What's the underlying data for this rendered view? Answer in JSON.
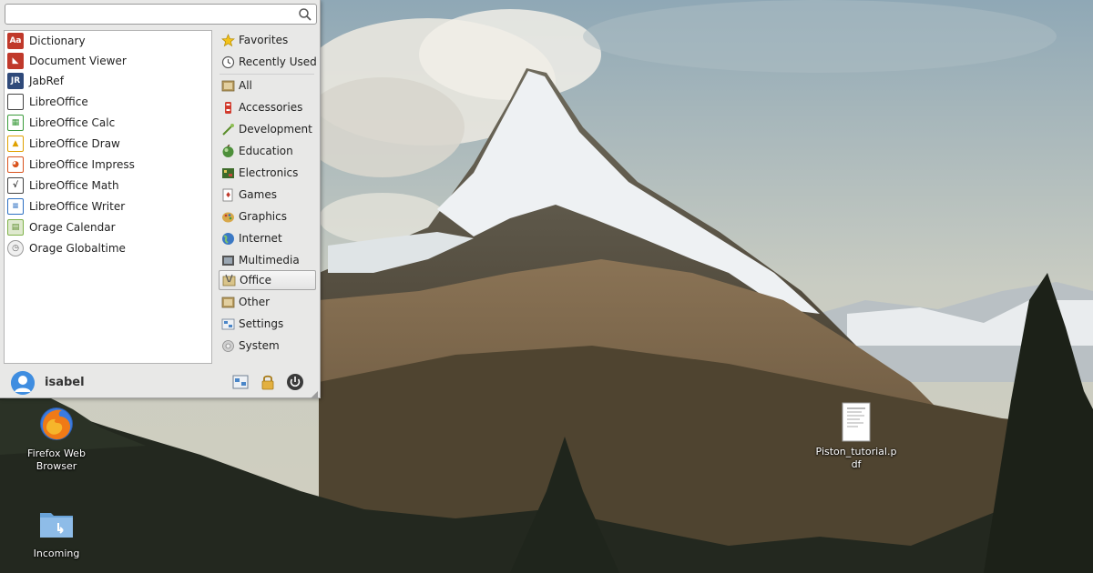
{
  "menu": {
    "search": {
      "placeholder": "",
      "value": "",
      "icon": "search-icon"
    },
    "applications": [
      {
        "label": "Dictionary",
        "icon": "dictionary-icon",
        "color": "#c0392b"
      },
      {
        "label": "Document Viewer",
        "icon": "document-viewer-icon",
        "color": "#c0392b"
      },
      {
        "label": "JabRef",
        "icon": "jabref-icon",
        "color": "#2f4a7a"
      },
      {
        "label": "LibreOffice",
        "icon": "libreoffice-icon",
        "color": "#444444"
      },
      {
        "label": "LibreOffice Calc",
        "icon": "libreoffice-calc-icon",
        "color": "#3b9b3b"
      },
      {
        "label": "LibreOffice Draw",
        "icon": "libreoffice-draw-icon",
        "color": "#e0a100"
      },
      {
        "label": "LibreOffice Impress",
        "icon": "libreoffice-impress-icon",
        "color": "#d9541e"
      },
      {
        "label": "LibreOffice Math",
        "icon": "libreoffice-math-icon",
        "color": "#444444"
      },
      {
        "label": "LibreOffice Writer",
        "icon": "libreoffice-writer-icon",
        "color": "#2d6fc2"
      },
      {
        "label": "Orage Calendar",
        "icon": "calendar-icon",
        "color": "#7fb24a"
      },
      {
        "label": "Orage Globaltime",
        "icon": "clock-icon",
        "color": "#9a9a9a"
      }
    ],
    "categories": [
      {
        "label": "Favorites",
        "icon": "star-icon"
      },
      {
        "label": "Recently Used",
        "icon": "history-icon"
      },
      {
        "label": "All",
        "icon": "all-folder-icon"
      },
      {
        "label": "Accessories",
        "icon": "accessories-icon"
      },
      {
        "label": "Development",
        "icon": "development-icon"
      },
      {
        "label": "Education",
        "icon": "education-icon"
      },
      {
        "label": "Electronics",
        "icon": "electronics-icon"
      },
      {
        "label": "Games",
        "icon": "games-icon"
      },
      {
        "label": "Graphics",
        "icon": "graphics-icon"
      },
      {
        "label": "Internet",
        "icon": "internet-icon"
      },
      {
        "label": "Multimedia",
        "icon": "multimedia-icon"
      },
      {
        "label": "Office",
        "icon": "office-icon",
        "selected": true
      },
      {
        "label": "Other",
        "icon": "other-icon"
      },
      {
        "label": "Settings",
        "icon": "settings-icon"
      },
      {
        "label": "System",
        "icon": "system-icon"
      }
    ],
    "footer": {
      "username": "isabel",
      "avatar_icon": "user-avatar-icon",
      "settings_icon": "all-settings-icon",
      "lock_icon": "lock-screen-icon",
      "power_icon": "power-icon"
    }
  },
  "desktop": {
    "icons": [
      {
        "label": "Firefox Web Browser",
        "icon": "firefox-icon"
      },
      {
        "label": "Incoming",
        "icon": "folder-icon"
      },
      {
        "label": "Piston_tutorial.pdf",
        "icon": "pdf-document-icon"
      }
    ]
  },
  "colors": {
    "menu_background": "#e8e8e7",
    "selection_border": "#a6a6a6",
    "avatar_blue": "#3f8de0"
  }
}
